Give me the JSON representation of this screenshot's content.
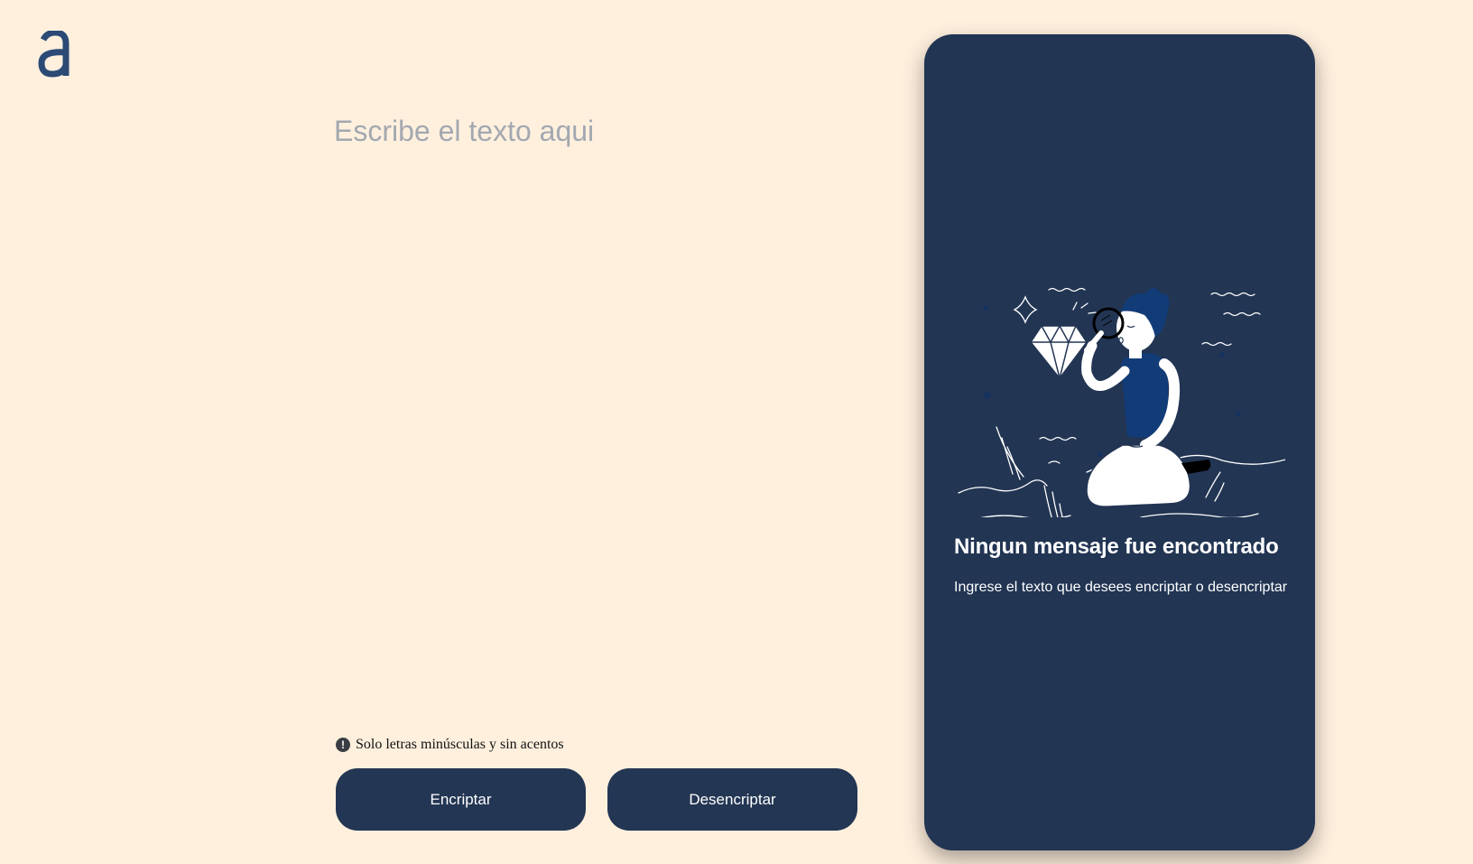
{
  "app": {
    "logo_letter": "a",
    "brand_color": "#2B4A75",
    "background_color": "#FFF0DE"
  },
  "editor": {
    "placeholder": "Escribe el texto aqui",
    "value": ""
  },
  "hint": {
    "icon": "exclamation-circle-icon",
    "text": "Solo letras minúsculas y sin acentos"
  },
  "actions": {
    "encrypt_label": "Encriptar",
    "decrypt_label": "Desencriptar",
    "button_color": "#233653"
  },
  "output": {
    "panel_color": "#223553",
    "illustration": "person-with-magnifying-glass-and-diamond-illustration",
    "empty_title": "Ningun mensaje fue encontrado",
    "empty_subtitle": "Ingrese el texto que desees encriptar o desencriptar"
  }
}
